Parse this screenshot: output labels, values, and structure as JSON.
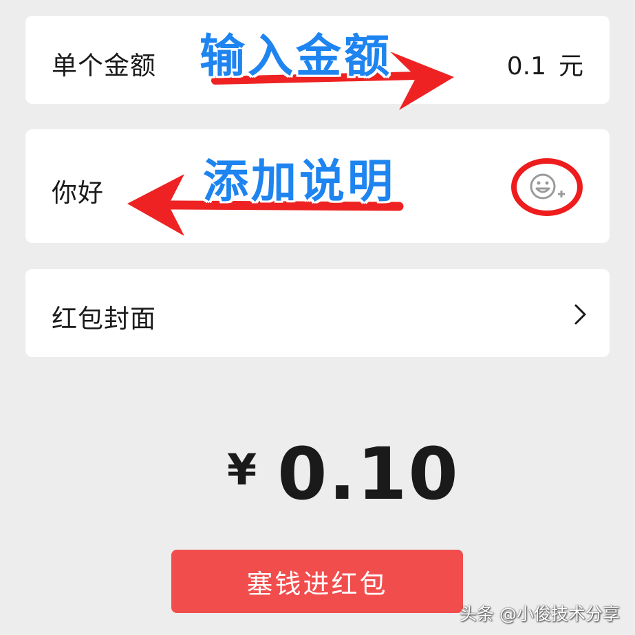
{
  "amount_row": {
    "label": "单个金额",
    "value": "0.1",
    "unit": "元"
  },
  "note_row": {
    "text": "你好",
    "emoji_icon": "emoji-add-icon"
  },
  "cover_row": {
    "label": "红包封面",
    "chevron_icon": "chevron-right-icon"
  },
  "total": {
    "currency": "¥",
    "value": "0.10"
  },
  "submit_button": {
    "label": "塞钱进红包"
  },
  "annotations": {
    "amount_hint": "输入金额",
    "note_hint": "添加说明"
  },
  "watermark": "头条 @小俊技术分享",
  "colors": {
    "background": "#ededed",
    "card": "#ffffff",
    "button": "#f24d4d",
    "annotation_text": "#1e84f0",
    "annotation_arrow": "#ee2222"
  }
}
